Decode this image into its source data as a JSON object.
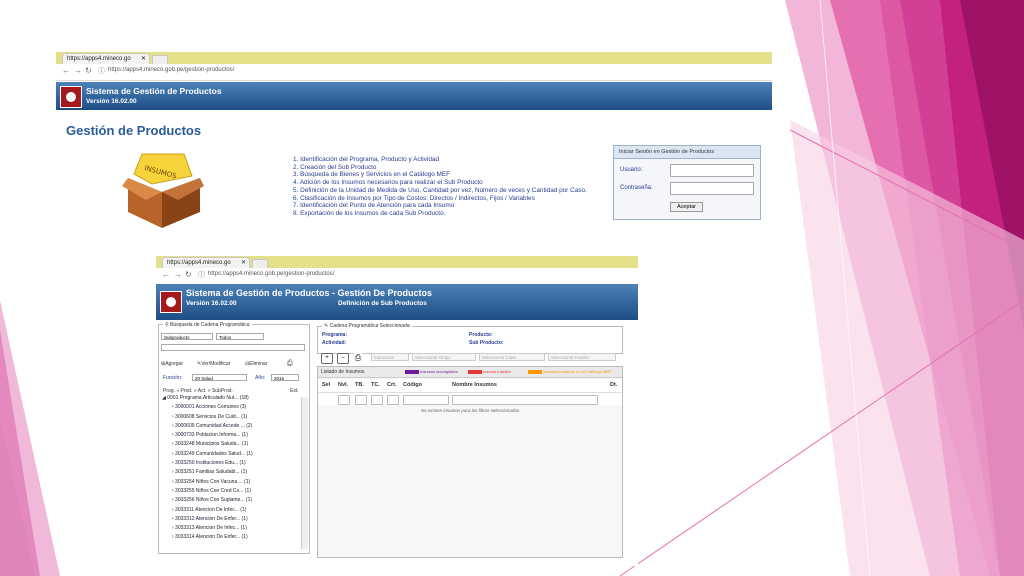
{
  "colors": {
    "banner": "#2f6aa6",
    "tabbar": "#e4e089",
    "magenta": "#c3207f",
    "link": "#2a3c8f"
  },
  "top": {
    "tab_title": "https://apps4.mineco.go",
    "url": "https://apps4.mineco.gob.pe/gestion-productos/",
    "system_title": "Sistema de Gestión de Productos",
    "version": "Versión 16.02.00",
    "page_title": "Gestión de Productos",
    "box_label": "INSUMOS",
    "steps": [
      "1. Identificación del Programa, Producto y Actividad",
      "2. Creación del Sub Producto",
      "3. Búsqueda de Bienes y Servicios en el Catálogo MEF",
      "4. Adición de los Insumos necesarios para realizar el Sub Producto",
      "5. Definición de la Unidad de Medida de Uso, Cantidad por vez, Número de veces y Cantidad por Caso.",
      "6. Clasificación de Insumos por Tipo de Costos: Directos / Indirectos, Fijos / Variables",
      "7. Identificación del Punto de Atención para cada Insumo",
      "8. Exportación de los Insumos de cada Sub Producto."
    ],
    "login": {
      "header": "Iniciar Sesión en Gestión de Productos",
      "user_label": "Usuario:",
      "pass_label": "Contraseña:",
      "button": "Aceptar"
    }
  },
  "bottom": {
    "tab_title": "https://apps4.mineco.go",
    "url": "https://apps4.mineco.gob.pe/gestion-productos/",
    "system_title": "Sistema de Gestión de Productos - Gestión De Productos",
    "version": "Versión 16.02.00",
    "subtitle": "Definición de Sub Productos",
    "search_legend": "Búsqueda de Cadena Programática",
    "select_sub": "Subproducto",
    "select_all": "Todos",
    "btn_add": "Agregar",
    "btn_view": "Ver/Modificar",
    "btn_delete": "Eliminar",
    "func_label": "Función:",
    "func_value": "20 Salud",
    "year_label": "Año:",
    "year_value": "2016",
    "tree_header": "Prog. » Prod. » Act. » SubProd.",
    "tree_header_right": "Est.",
    "tree": [
      "◢ 0001 Programa Articulado Nut... (18)",
      "› 3000001 Acciones Comunes (3)",
      "› 3000608 Servicios De Cuid... (1)",
      "› 3000609 Comunidad Accede ... (2)",
      "› 3000733 Poblacion Informa... (1)",
      "› 3033248 Municipios Saluda... (1)",
      "› 3033249 Comunidades Salud... (1)",
      "› 3033250 Instituciones Edu... (1)",
      "› 3033251 Familias Saludabl... (1)",
      "› 3033254 Niños Con Vacuna ... (1)",
      "› 3033255 Niños Con Cred Co... (1)",
      "› 3033256 Niños Con Suplame... (1)",
      "› 3033311 Atencion De Infec... (1)",
      "› 3033312 Atencion De Enfer... (1)",
      "› 3033313 Atencion De Infec... (1)",
      "› 3033314 Atencion De Enfer... (1)"
    ],
    "chain_legend": "Cadena Programática Seleccionada",
    "programa": "Programa:",
    "actividad": "Actividad:",
    "producto": "Producto:",
    "subproducto": "Sub Producto:",
    "toolbar_selects": [
      "Estructura",
      "Seleccionar Grupo",
      "Seleccionar Clase",
      "Seleccionar Familia"
    ],
    "list_title": "Listado de Insumos",
    "legend": [
      "Insumos incompletos",
      "Insumo Inactivo",
      "Insumos Inactivos en el Catálogo MEF"
    ],
    "legend_colors": [
      "#6a1b9a",
      "#e53935",
      "#ff9800"
    ],
    "columns": [
      "Sel",
      "Nvl.",
      "TB.",
      "TC.",
      "Crt.",
      "Código",
      "Nombre Insumos",
      "Dt."
    ],
    "empty_msg": "No existen insumos para los filtros seleccionados"
  }
}
